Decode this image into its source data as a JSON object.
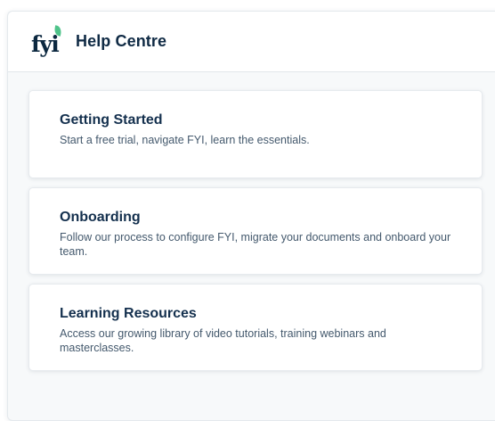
{
  "header": {
    "logo_text": "fyi",
    "title": "Help Centre"
  },
  "cards": [
    {
      "title": "Getting Started",
      "description": "Start a free trial, navigate FYI, learn the essentials."
    },
    {
      "title": "Onboarding",
      "description": "Follow our process to configure FYI, migrate your documents and onboard your team."
    },
    {
      "title": "Learning Resources",
      "description": "Access our growing library of video tutorials, training webinars and masterclasses."
    }
  ],
  "colors": {
    "brand_navy": "#0c2840",
    "brand_green": "#4fc38a",
    "panel_bg": "#f7f9fa"
  }
}
